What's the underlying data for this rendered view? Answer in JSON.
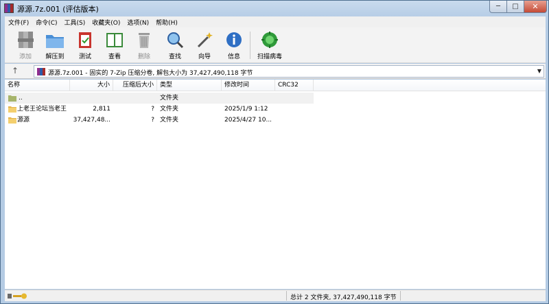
{
  "window": {
    "title": "源源.7z.001 (评估版本)"
  },
  "menu": [
    "文件(F)",
    "命令(C)",
    "工具(S)",
    "收藏夹(O)",
    "选项(N)",
    "帮助(H)"
  ],
  "toolbar": {
    "add": "添加",
    "extract": "解压到",
    "test": "测试",
    "view": "查看",
    "delete": "删除",
    "find": "查找",
    "wizard": "向导",
    "info": "信息",
    "scan": "扫描病毒"
  },
  "address": {
    "text": "源源.7z.001 - 固实的 7-Zip 压缩分卷, 解包大小为 37,427,490,118 字节",
    "up": "↑",
    "dropdown": "▼"
  },
  "columns": [
    "名称",
    "大小",
    "压缩后大小",
    "类型",
    "修改时间",
    "CRC32"
  ],
  "rows": [
    {
      "name": "..",
      "size": "",
      "packed": "",
      "type": "文件夹",
      "modified": "",
      "crc": ""
    },
    {
      "name": "上老王论坛当老王",
      "size": "2,811",
      "packed": "?",
      "type": "文件夹",
      "modified": "2025/1/9 1:12",
      "crc": ""
    },
    {
      "name": "源源",
      "size": "37,427,48...",
      "packed": "?",
      "type": "文件夹",
      "modified": "2025/4/27 10...",
      "crc": ""
    }
  ],
  "status": {
    "summary": "总计 2 文件夹, 37,427,490,118 字节"
  },
  "controls": {
    "minimize": "─",
    "maximize": "□",
    "close": "✕"
  }
}
